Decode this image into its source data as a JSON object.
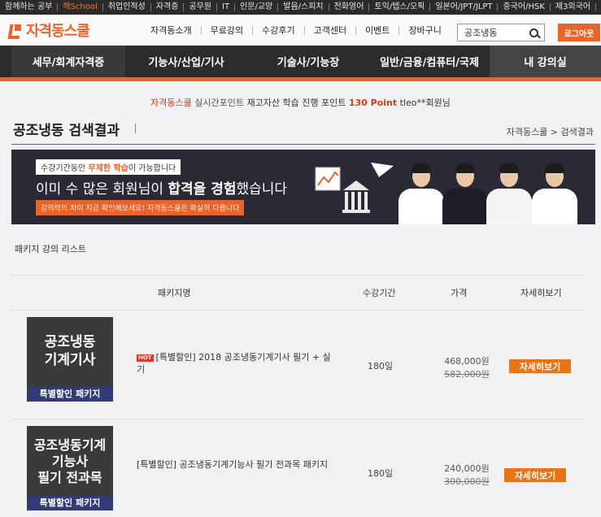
{
  "topbar": {
    "items": [
      "함께하는 공부",
      "해School",
      "취업인적성",
      "자격증",
      "공무원",
      "IT",
      "인문/교양",
      "발음/스피치",
      "전화영어",
      "토익/텝스/오픽",
      "일본어/JPT/JLPT",
      "중국어/HSK",
      "제3외국어"
    ]
  },
  "header": {
    "logo_text": "자격동스쿨",
    "nav": [
      "자격동소개",
      "무료강의",
      "수강후기",
      "고객센터",
      "이벤트",
      "장바구니"
    ],
    "search_value": "공조냉동",
    "logout_label": "로그아웃"
  },
  "categories": [
    "세무/회계자격증",
    "기능사/산업/기사",
    "기술사/기능장",
    "일반/금융/컴퓨터/국제",
    "내 강의실"
  ],
  "ticker": {
    "brand": "자격동스쿨",
    "label": "실시간포인트",
    "message": "재고자산 학습 진행 포인트",
    "points": "130 Point",
    "user": "tleo**회원님"
  },
  "page": {
    "title": "공조냉동 검색결과",
    "breadcrumb": "자격동스쿨 > 검색결과"
  },
  "banner": {
    "top_pre": "수강기간동안 ",
    "top_highlight": "무제한 학습",
    "top_post": "이 가능합니다",
    "main_pre": "이미 수 많은 회원님이 ",
    "main_bold": "합격을 경험",
    "main_post": "했습니다",
    "sub": "강의력의 차이 지금 확인해보세요! 자격동스쿨은 확실히 다릅니다"
  },
  "section_label": "패키지 강의 리스트",
  "table": {
    "headers": {
      "name": "패키지명",
      "period": "수강기간",
      "price": "가격",
      "detail": "자세히보기"
    },
    "rows": [
      {
        "thumb_title_1": "공조냉동",
        "thumb_title_2": "기계기사",
        "thumb_title_3": "",
        "thumb_label": "특별할인 패키지",
        "hot": "HOT",
        "name": "[특별할인] 2018 공조냉동기계기사 필기 + 실기",
        "period": "180일",
        "price_now": "468,000원",
        "price_old": "582,000원",
        "detail_label": "자세히보기"
      },
      {
        "thumb_title_1": "공조냉동기계",
        "thumb_title_2": "기능사",
        "thumb_title_3": "필기 전과목",
        "thumb_label": "특별할인 패키지",
        "hot": "",
        "name": "[특별할인] 공조냉동기계기능사 필기 전과목 패키지",
        "period": "180일",
        "price_now": "240,000원",
        "price_old": "300,000원",
        "detail_label": "자세히보기"
      }
    ]
  },
  "colors": {
    "accent": "#e8642a",
    "dark_nav": "#2c2c2c",
    "thumb_label": "#333a78"
  }
}
